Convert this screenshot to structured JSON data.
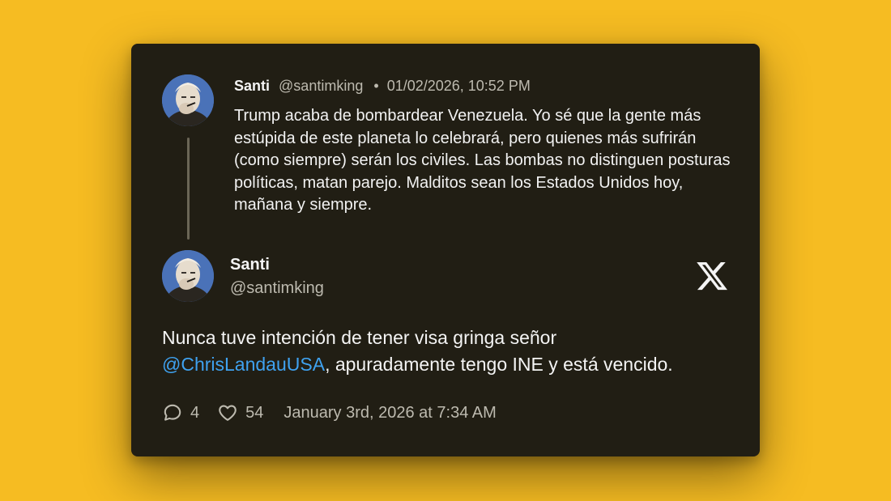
{
  "quoted": {
    "name": "Santi",
    "handle": "@santimking",
    "separator": "•",
    "timestamp": "01/02/2026, 10:52 PM",
    "text": "Trump acaba de bombardear Venezuela. Yo sé que la gente más estúpida de este planeta lo celebrará, pero quienes más sufrirán (como siempre) serán los civiles. Las bombas no distinguen posturas políticas, matan parejo. Malditos sean los Estados Unidos hoy, mañana y siempre."
  },
  "post": {
    "name": "Santi",
    "handle": "@santimking",
    "text_before": "Nunca tuve intención de tener visa gringa señor ",
    "mention": "@ChrisLandauUSA",
    "text_after": ", apuradamente tengo INE y está vencido.",
    "replies": "4",
    "likes": "54",
    "date": "January 3rd, 2026 at 7:34 AM"
  },
  "icons": {
    "platform": "x-logo-icon",
    "reply": "comment-bubble-icon",
    "like": "heart-icon"
  },
  "colors": {
    "background": "#F6BC22",
    "card": "#211E14",
    "mention": "#3FA2F0",
    "muted": "#BDBAAF"
  }
}
